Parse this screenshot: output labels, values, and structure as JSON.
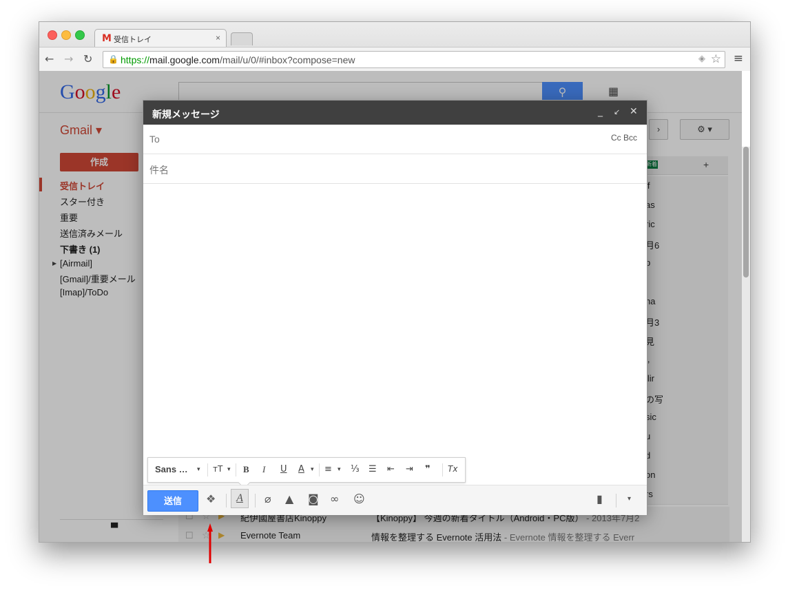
{
  "browser": {
    "tab_title": "受信トレイ",
    "tab_close": "×",
    "url_scheme": "https://",
    "url_host": "mail.google.com",
    "url_path": "/mail/u/0/#inbox?compose=new"
  },
  "gmail": {
    "logo": "Google",
    "account_label": "Gmail ▾",
    "compose_button": "作成",
    "sidebar": [
      {
        "label": "受信トレイ",
        "style": "active"
      },
      {
        "label": "スター付き",
        "style": ""
      },
      {
        "label": "重要",
        "style": ""
      },
      {
        "label": "送信済みメール",
        "style": ""
      },
      {
        "label": "下書き (1)",
        "style": "bold"
      },
      {
        "label": "[Airmail]",
        "style": ""
      },
      {
        "label": "[Gmail]/重要メール",
        "style": ""
      },
      {
        "label": "[Imap]/ToDo",
        "style": ""
      }
    ],
    "ghost_fragments": [
      "if",
      "as",
      "ric",
      "月6",
      "p",
      "",
      "ha",
      "月3",
      "見",
      "i,",
      "llir",
      "の写",
      "sic",
      "u",
      "d",
      "on",
      "rs"
    ],
    "visible_rows": [
      {
        "sender": "紀伊國屋書店Kinoppy",
        "subject": "【Kinoppy】 今週の新着タイトル（Android・PC版）",
        "snippet": " - 2013年7月2"
      },
      {
        "sender": "Evernote Team",
        "subject": "情報を整理する Evernote 活用法",
        "snippet": " - Evernote 情報を整理する Everr"
      }
    ]
  },
  "compose": {
    "title": "新規メッセージ",
    "minimize": "_",
    "expand": "↙",
    "close": "✕",
    "to_label": "To",
    "cc_bcc": "Cc  Bcc",
    "subject_label": "件名",
    "format_bar": {
      "font": "Sans …",
      "size": "тT",
      "bold": "B",
      "italic": "I",
      "underline": "U",
      "text_color": "A",
      "align": "≡",
      "numbered": "⅓",
      "bulleted": "☰",
      "indent_less": "⇤",
      "indent_more": "⇥",
      "quote": "❞",
      "clear": "Tx"
    },
    "send_button": "送信",
    "bottom_icons": [
      "dropbox-icon",
      "formatting-icon",
      "attach-icon",
      "drive-icon",
      "photo-icon",
      "link-icon",
      "emoji-icon",
      "trash-icon",
      "more-options-icon"
    ]
  },
  "colors": {
    "gmail_red": "#d14836",
    "send_blue": "#4d90fe",
    "arrow_red": "#e00000"
  }
}
